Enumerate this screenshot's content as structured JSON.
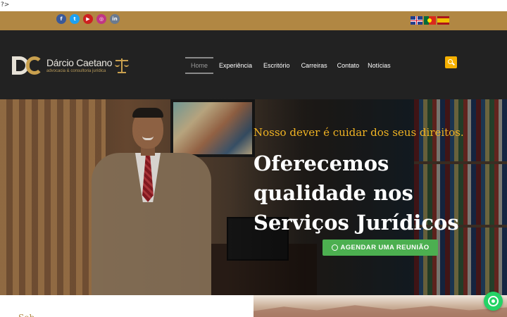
{
  "stray_text": "?>",
  "topbar": {
    "social": [
      {
        "icon": "facebook-icon",
        "glyph": "f"
      },
      {
        "icon": "twitter-icon",
        "glyph": "t"
      },
      {
        "icon": "youtube-icon",
        "glyph": "▶"
      },
      {
        "icon": "instagram-icon",
        "glyph": "◎"
      },
      {
        "icon": "linkedin-icon",
        "glyph": "in"
      }
    ],
    "languages": [
      "en",
      "pt",
      "es"
    ]
  },
  "header": {
    "logo": {
      "name": "Dárcio Caetano",
      "tagline": "advocacia & consultoria jurídica"
    },
    "nav": [
      "Home",
      "Experiência",
      "Escritório",
      "Carreiras",
      "Contato",
      "Notícias"
    ],
    "active_nav": "Home"
  },
  "hero": {
    "subtitle": "Nosso dever é cuidar dos seus direitos.",
    "title": "Oferecemos qualidade nos Serviços Jurídicos",
    "cta": "AGENDAR UMA REUNIÃO"
  },
  "below": {
    "heading_fragment": "Sobre"
  },
  "colors": {
    "topbar": "#b18743",
    "header": "#222222",
    "accent": "#f0b323",
    "cta": "#4caf50",
    "whatsapp": "#25d366"
  }
}
